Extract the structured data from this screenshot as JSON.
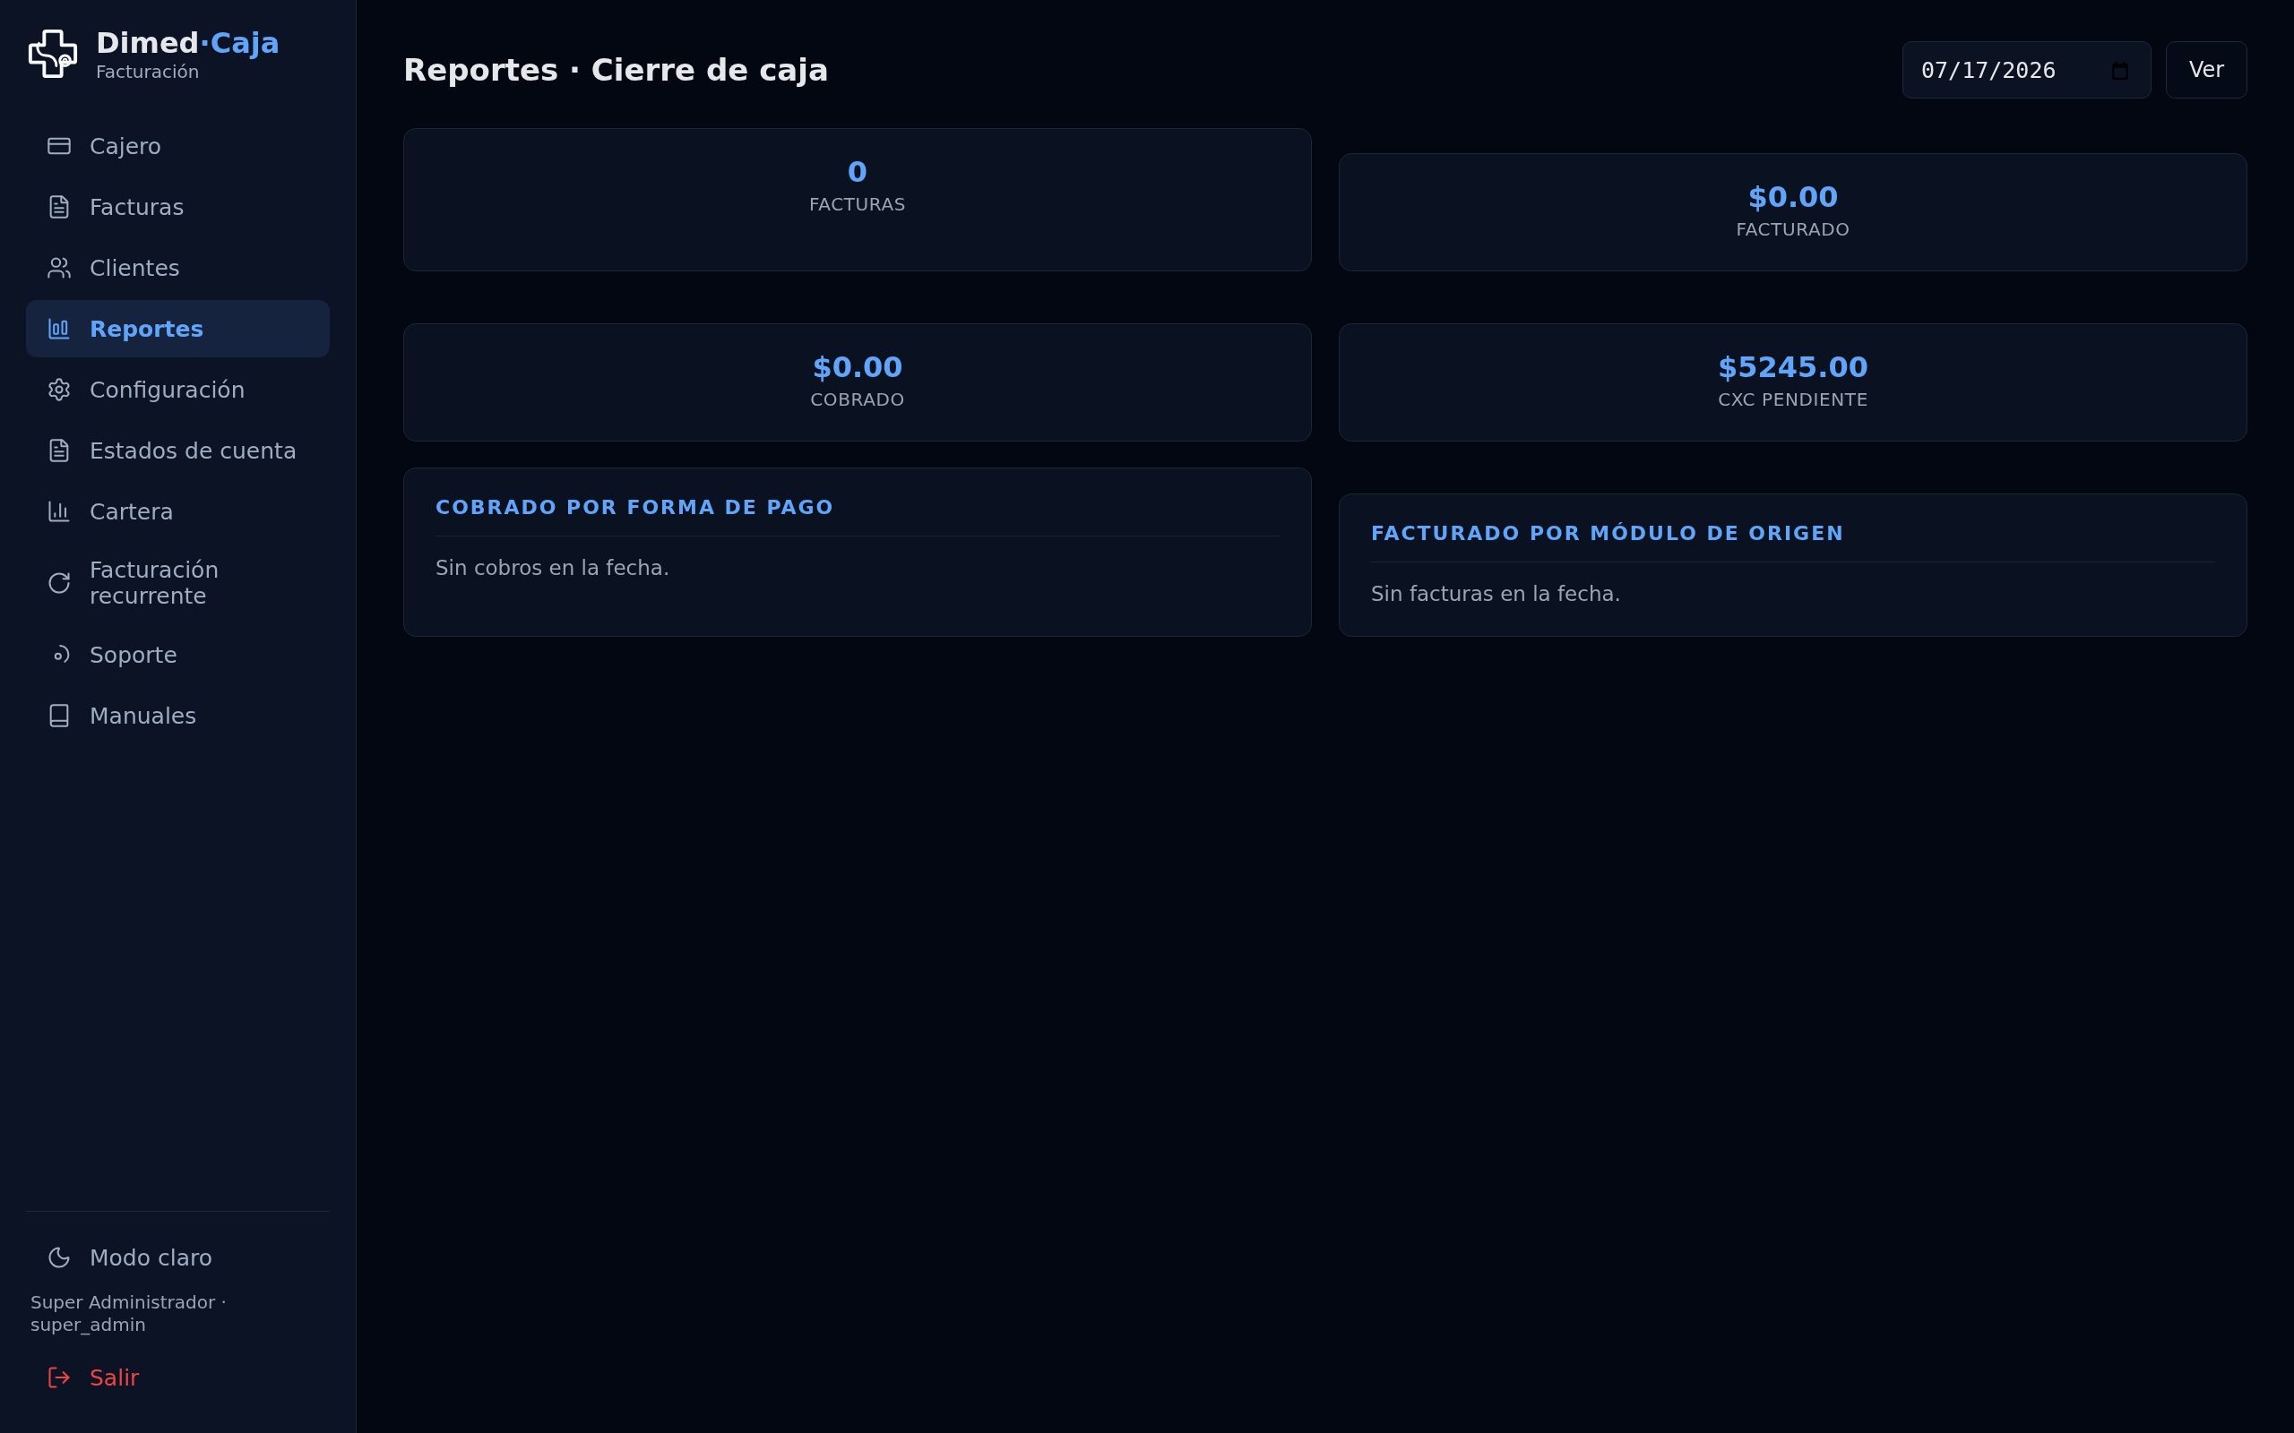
{
  "brand": {
    "name": "Dimed",
    "accent": "·Caja",
    "subtitle": "Facturación"
  },
  "sidebar": {
    "items": [
      {
        "label": "Cajero",
        "selected": false
      },
      {
        "label": "Facturas",
        "selected": false
      },
      {
        "label": "Clientes",
        "selected": false
      },
      {
        "label": "Reportes",
        "selected": true
      },
      {
        "label": "Configuración",
        "selected": false
      },
      {
        "label": "Estados de cuenta",
        "selected": false
      },
      {
        "label": "Cartera",
        "selected": false
      },
      {
        "label": "Facturación recurrente",
        "selected": false
      },
      {
        "label": "Soporte",
        "selected": false
      },
      {
        "label": "Manuales",
        "selected": false
      }
    ],
    "footer": {
      "theme_toggle": "Modo claro",
      "user": "Super Administrador · super_admin",
      "logout": "Salir"
    }
  },
  "header": {
    "title": "Reportes · Cierre de caja",
    "date_field": {
      "value": "07/17/2026"
    },
    "view_button": "Ver"
  },
  "kpi_cards": [
    {
      "value": "0",
      "label": "FACTURAS"
    },
    {
      "value": "$0.00",
      "label": "FACTURADO"
    },
    {
      "value": "$0.00",
      "label": "COBRADO"
    },
    {
      "value": "$5245.00",
      "label": "CXC PENDIENTE"
    }
  ],
  "panels": [
    {
      "title": "COBRADO POR FORMA DE PAGO",
      "empty_text": "Sin cobros en la fecha."
    },
    {
      "title": "FACTURADO POR MÓDULO DE ORIGEN",
      "empty_text": "Sin facturas en la fecha."
    }
  ]
}
